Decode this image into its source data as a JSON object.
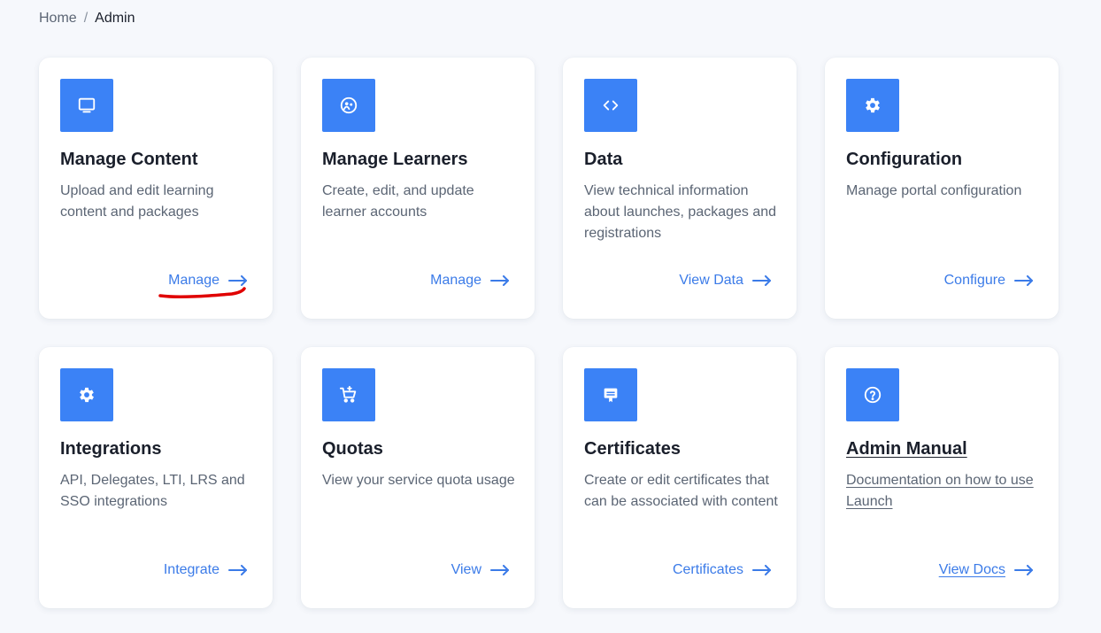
{
  "breadcrumb": {
    "home": "Home",
    "separator": "/",
    "current": "Admin"
  },
  "colors": {
    "accent": "#3b82f6",
    "link": "#3b7be8",
    "annotation": "#e00000"
  },
  "cards": [
    {
      "title": "Manage Content",
      "description": "Upload and edit learning content and packages",
      "action": "Manage",
      "icon": "monitor-icon"
    },
    {
      "title": "Manage Learners",
      "description": "Create, edit, and update learner accounts",
      "action": "Manage",
      "icon": "users-icon"
    },
    {
      "title": "Data",
      "description": "View technical information about launches, packages and registrations",
      "action": "View Data",
      "icon": "code-icon"
    },
    {
      "title": "Configuration",
      "description": "Manage portal configuration",
      "action": "Configure",
      "icon": "gear-icon"
    },
    {
      "title": "Integrations",
      "description": "API, Delegates, LTI, LRS and SSO integrations",
      "action": "Integrate",
      "icon": "gear-icon"
    },
    {
      "title": "Quotas",
      "description": "View your service quota usage",
      "action": "View",
      "icon": "cart-icon"
    },
    {
      "title": "Certificates",
      "description": "Create or edit certificates that can be associated with content",
      "action": "Certificates",
      "icon": "certificate-icon"
    },
    {
      "title": "Admin Manual",
      "description": "Documentation on how to use Launch",
      "action": "View Docs",
      "icon": "help-icon"
    }
  ]
}
